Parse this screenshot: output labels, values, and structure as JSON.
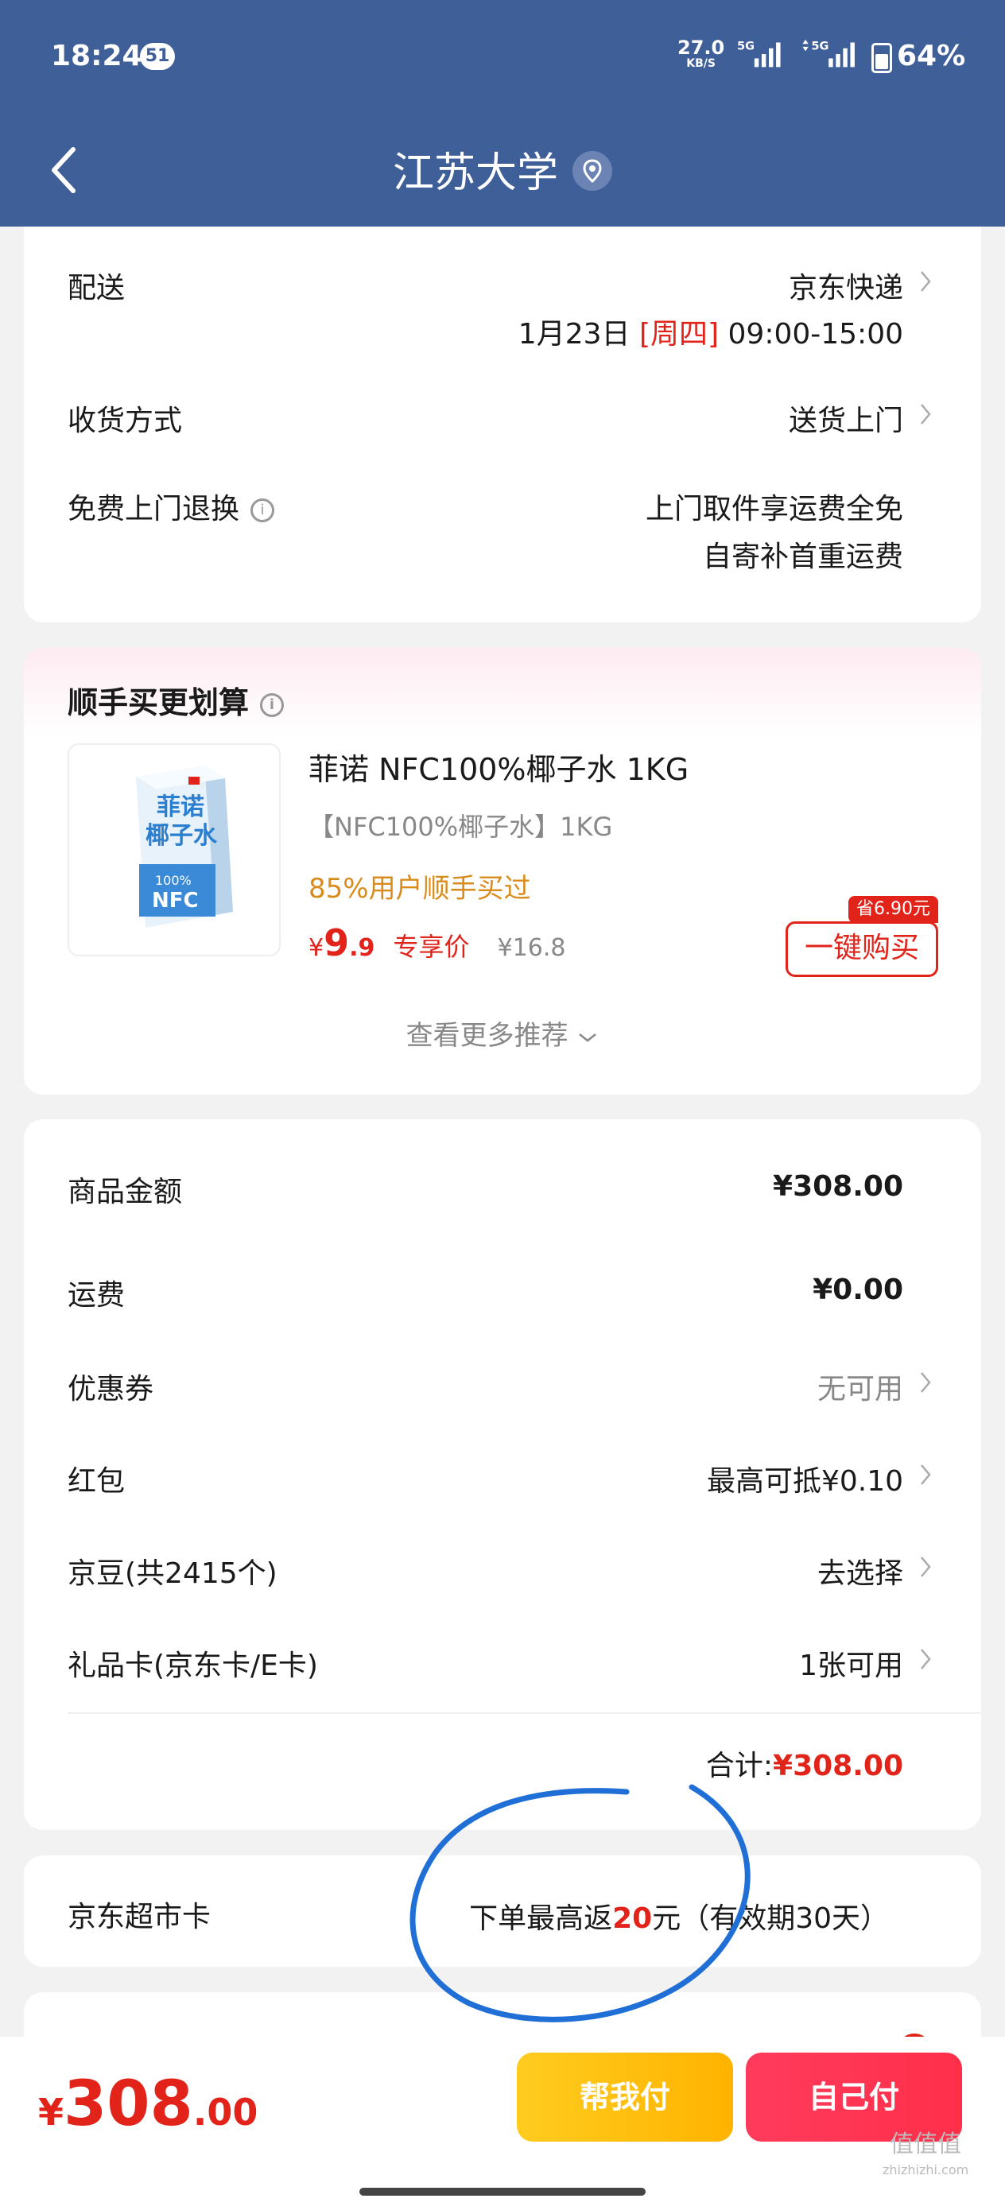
{
  "status_bar": {
    "time": "18:24",
    "notif_count": "51",
    "net_speed": "27.0",
    "net_unit": "KB/S",
    "sig1": "5G",
    "sig2": "5G",
    "battery": "64%"
  },
  "header": {
    "title": "江苏大学",
    "back_icon": "chevron-left-icon",
    "location_icon": "location-pin-icon"
  },
  "delivery": {
    "peisong_label": "配送",
    "peisong_value": "京东快递",
    "date": "1月23日",
    "weekday": "[周四]",
    "time": "09:00-15:00",
    "method_label": "收货方式",
    "method_value": "送货上门",
    "return_label": "免费上门退换",
    "return_line1": "上门取件享运费全免",
    "return_line2": "自寄补首重运费"
  },
  "recommend": {
    "title": "顺手买更划算",
    "product_name": "菲诺 NFC100%椰子水 1KG",
    "product_spec": "【NFC100%椰子水】1KG",
    "product_popularity": "85%用户顺手买过",
    "price_symbol": "¥",
    "price_int": "9",
    "price_dec": ".9",
    "price_tag": "专享价",
    "original_price": "¥16.8",
    "save_tag": "省6.90元",
    "buy_button": "一键购买",
    "more": "查看更多推荐",
    "pack_text_1": "菲诺",
    "pack_text_2": "椰子水",
    "pack_text_3": "100%",
    "pack_text_4": "NFC"
  },
  "costs": {
    "goods_label": "商品金额",
    "goods_value": "¥308.00",
    "shipping_label": "运费",
    "shipping_value": "¥0.00",
    "coupon_label": "优惠券",
    "coupon_value": "无可用",
    "redpacket_label": "红包",
    "redpacket_value": "最高可抵¥0.10",
    "beans_label": "京豆(共2415个)",
    "beans_value": "去选择",
    "giftcard_label": "礼品卡(京东卡/E卡)",
    "giftcard_value": "1张可用",
    "total_label": "合计:",
    "total_value": "¥308.00"
  },
  "supermarket": {
    "label": "京东超市卡",
    "text_a": "下单最高返",
    "text_amount": "20",
    "text_b": "元（有效期30天）"
  },
  "bottom": {
    "symbol": "¥",
    "amount_int": "308",
    "amount_dec": ".00",
    "help_pay": "帮我付",
    "self_pay": "自己付",
    "watermark": "值值值",
    "watermark_url": "zhizhizhi.com"
  },
  "colors": {
    "header": "#3f5f98",
    "accent_red": "#e2231a",
    "orange_text": "#d98c1c",
    "annotation_blue": "#1f6fd6"
  }
}
